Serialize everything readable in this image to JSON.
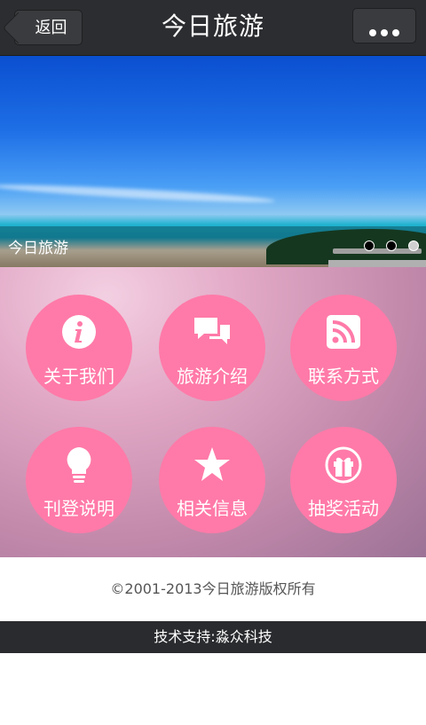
{
  "header": {
    "back_label": "返回",
    "title": "今日旅游"
  },
  "banner": {
    "caption": "今日旅游",
    "slide_count": 3,
    "active_slide": 3
  },
  "menu": {
    "items": [
      {
        "label": "关于我们",
        "icon": "info-icon"
      },
      {
        "label": "旅游介绍",
        "icon": "chat-bubbles-icon"
      },
      {
        "label": "联系方式",
        "icon": "rss-icon"
      },
      {
        "label": "刊登说明",
        "icon": "lightbulb-icon"
      },
      {
        "label": "相关信息",
        "icon": "star-icon"
      },
      {
        "label": "抽奖活动",
        "icon": "gift-icon"
      }
    ]
  },
  "footer": {
    "copyright": "©2001-2013今日旅游版权所有",
    "support": "技术支持:淼众科技"
  },
  "colors": {
    "topbar": "#2c2d30",
    "tile": "#ff7aa8",
    "support_bar": "#2a2b2e"
  }
}
